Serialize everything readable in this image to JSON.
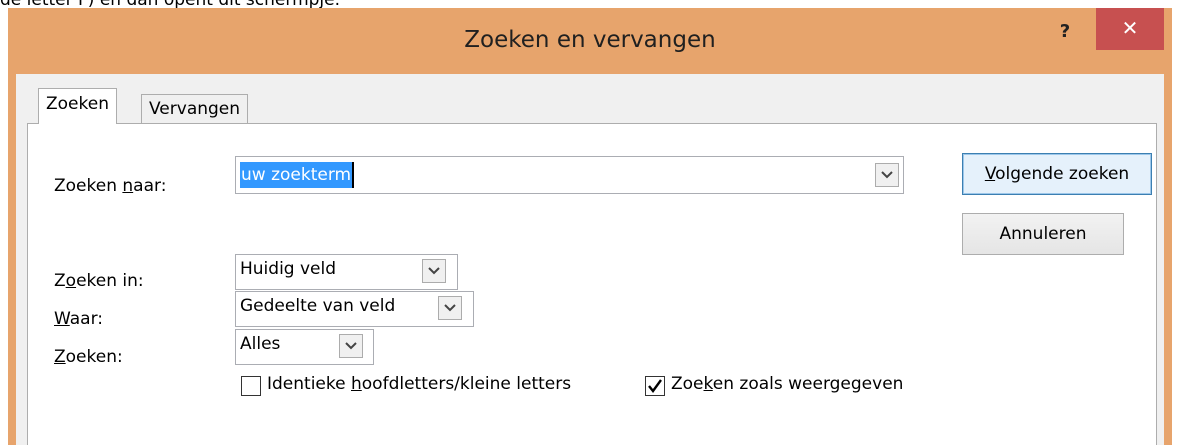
{
  "top_text": "de letter F) en dan opent dit schermpje.",
  "window": {
    "title": "Zoeken en vervangen",
    "help_glyph": "?",
    "close_glyph": "✕"
  },
  "tabs": [
    {
      "label": "Zoeken",
      "active": true
    },
    {
      "label": "Vervangen",
      "active": false
    }
  ],
  "find_what": {
    "label_pre": "Zoeken ",
    "label_u": "n",
    "label_post": "aar:",
    "value": "uw zoekterm"
  },
  "look_in": {
    "label_pre": "Z",
    "label_u": "o",
    "label_post": "eken in:",
    "value": "Huidig veld"
  },
  "match": {
    "label_u": "W",
    "label_post": "aar:",
    "value": "Gedeelte van veld"
  },
  "search": {
    "label_u": "Z",
    "label_post": "oeken:",
    "value": "Alles"
  },
  "buttons": {
    "find_next_u": "V",
    "find_next_rest": "olgende zoeken",
    "cancel": "Annuleren"
  },
  "options": {
    "match_case": {
      "pre": "Identieke ",
      "u": "h",
      "post": "oofdletters/kleine letters",
      "checked": false
    },
    "search_formatted": {
      "pre": "Zoe",
      "u": "k",
      "post": "en zoals weergegeven",
      "checked": true
    }
  },
  "colors": {
    "titlebar": "#e7a46c",
    "close_button": "#c75050",
    "selection": "#3399ff"
  }
}
